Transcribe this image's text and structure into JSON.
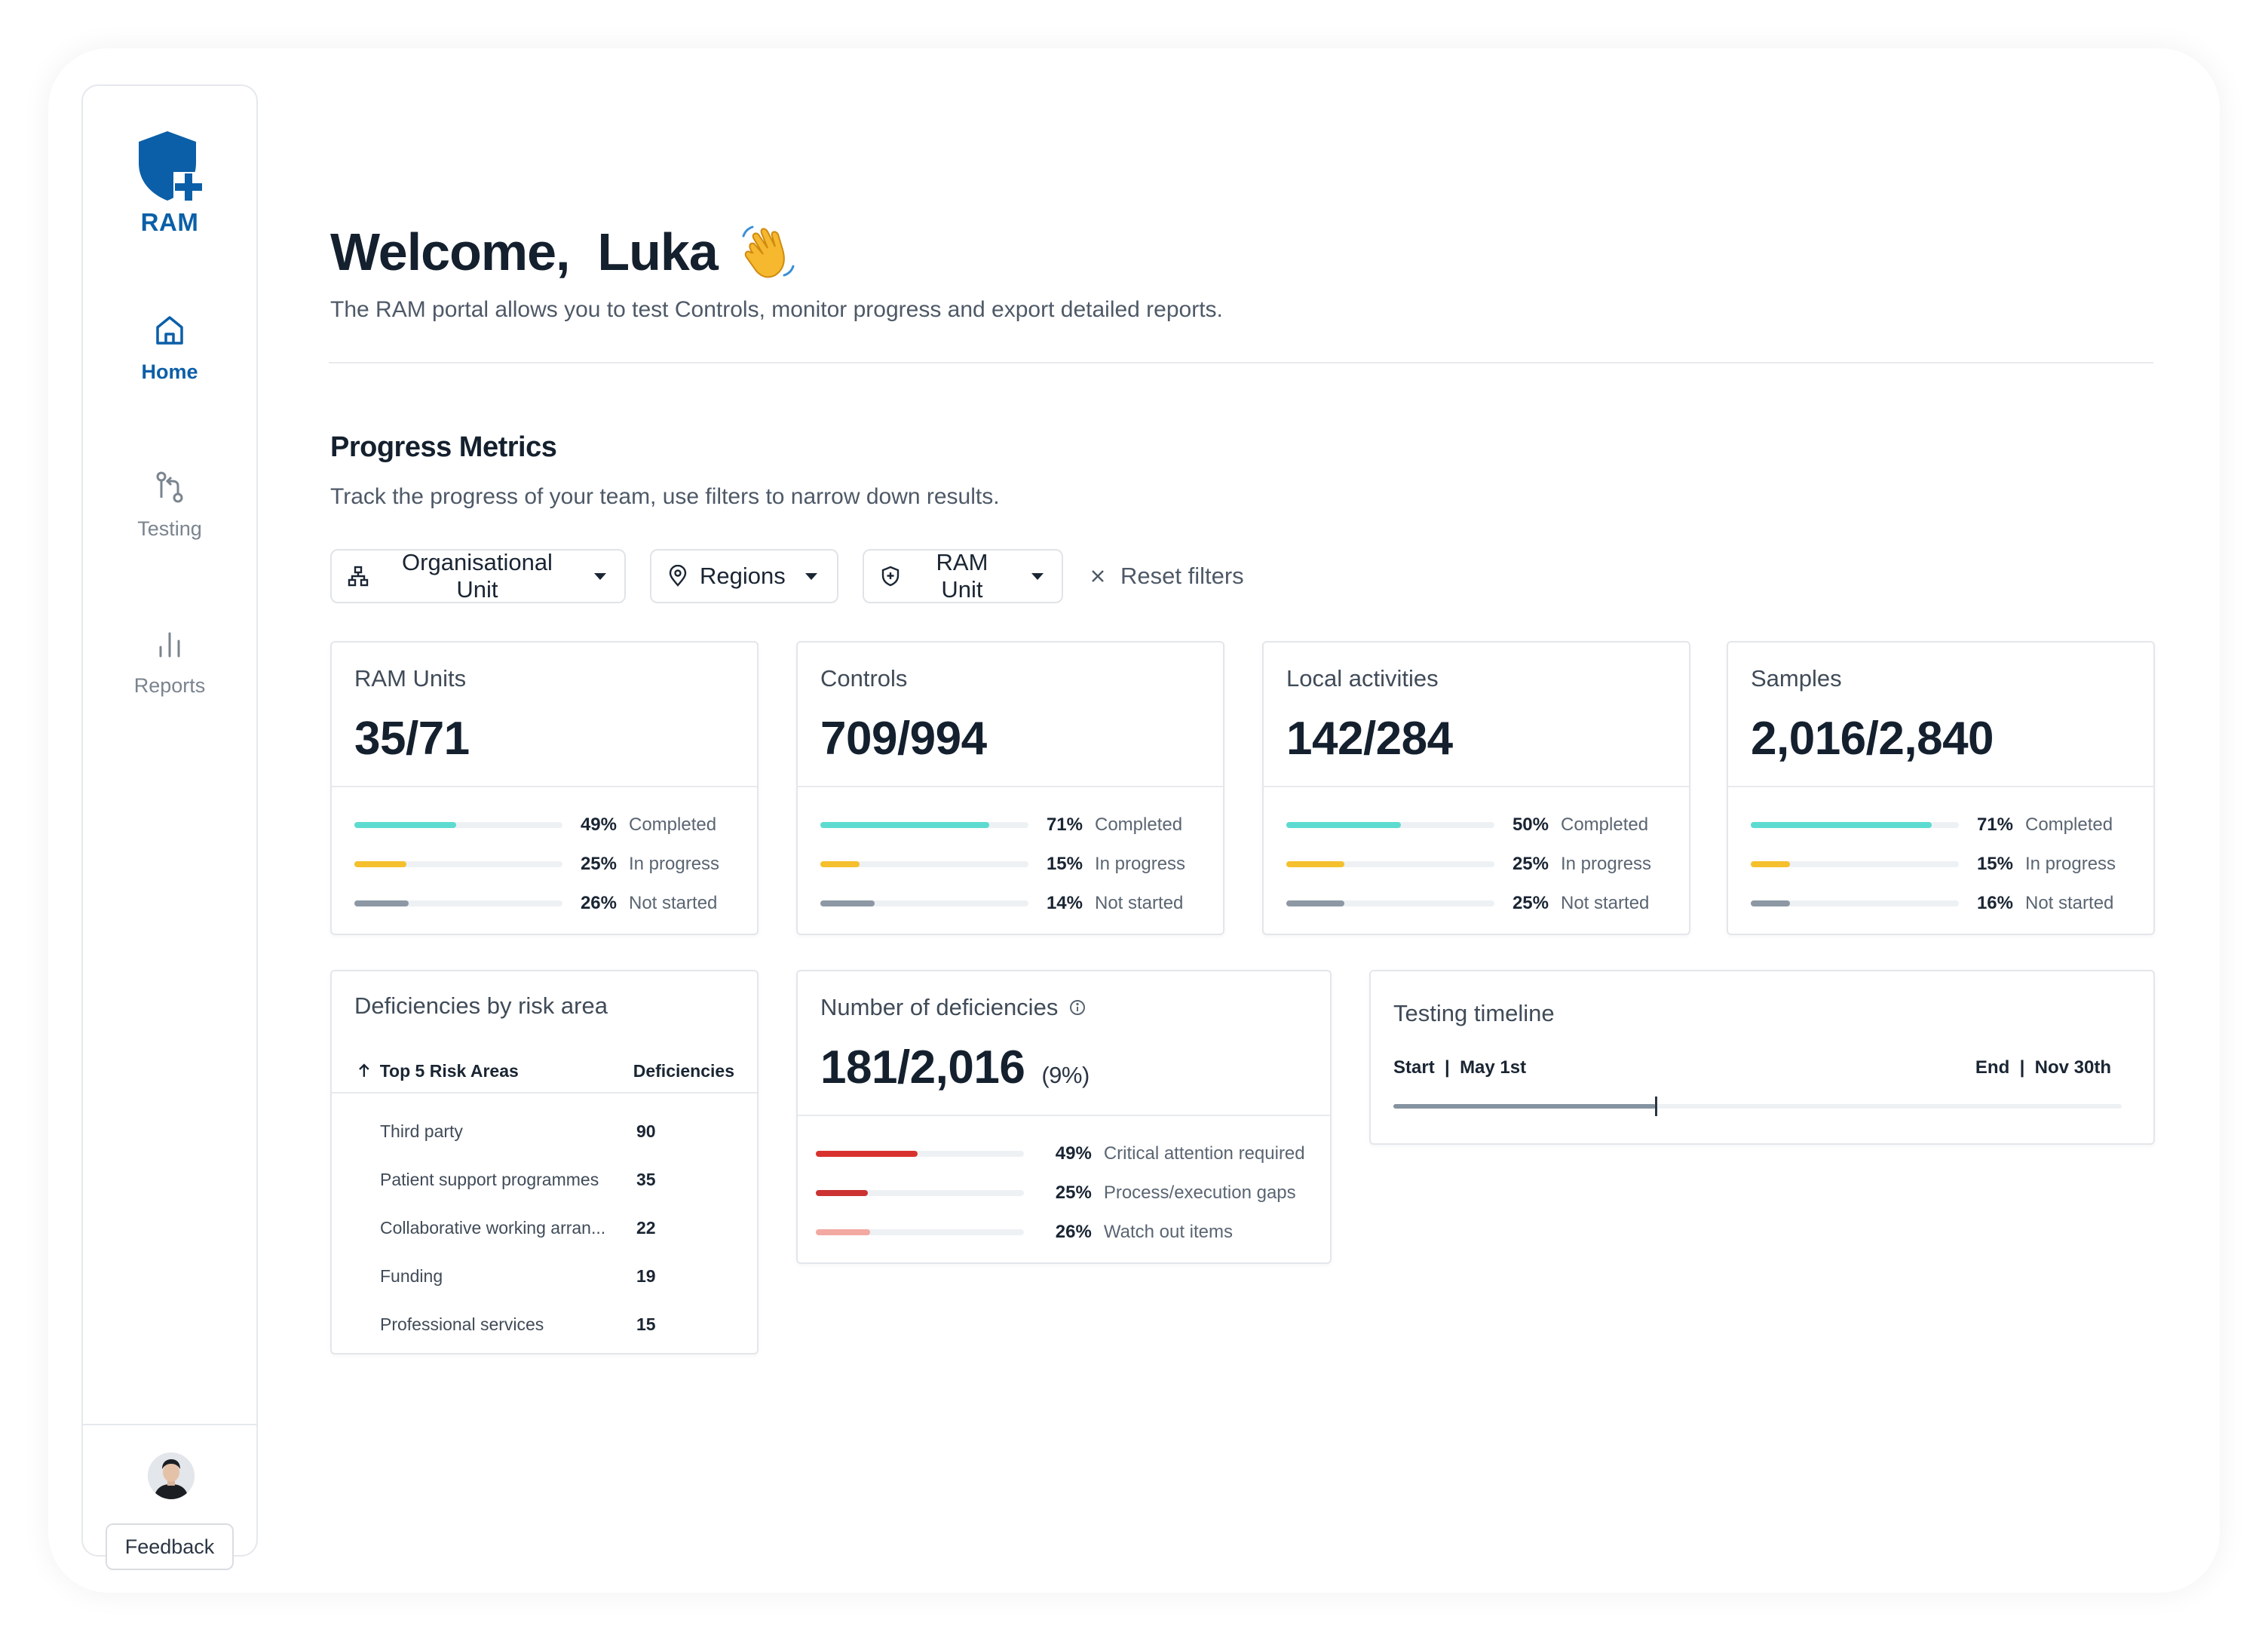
{
  "brand": {
    "logo_text": "RAM",
    "color": "#0b5fa8"
  },
  "nav": {
    "items": [
      {
        "label": "Home",
        "icon": "home-icon",
        "active": true
      },
      {
        "label": "Testing",
        "icon": "git-compare-icon",
        "active": false
      },
      {
        "label": "Reports",
        "icon": "bar-chart-icon",
        "active": false
      }
    ],
    "feedback_label": "Feedback"
  },
  "header": {
    "title": "Welcome,  Luka",
    "emoji": "waving-hand-icon",
    "subtitle": "The RAM portal allows you to test Controls, monitor progress and export detailed reports."
  },
  "section": {
    "title": "Progress Metrics",
    "subtitle": "Track the progress of your team, use filters to narrow down results."
  },
  "filters": {
    "items": [
      {
        "label": "Organisational Unit",
        "icon": "org-chart-icon"
      },
      {
        "label": "Regions",
        "icon": "location-pin-icon"
      },
      {
        "label": "RAM Unit",
        "icon": "shield-plus-icon"
      }
    ],
    "reset_label": "Reset filters"
  },
  "colors": {
    "completed": "#5ddbd0",
    "in_progress": "#f5c02e",
    "not_started": "#8d98a4",
    "critical": "#d9322e",
    "process": "#cc3232",
    "watch": "#f2a9a2"
  },
  "metrics": [
    {
      "label": "RAM Units",
      "value": "35/71",
      "rows": [
        {
          "pct": 49,
          "pct_text": "49%",
          "label": "Completed"
        },
        {
          "pct": 25,
          "pct_text": "25%",
          "label": "In progress"
        },
        {
          "pct": 26,
          "pct_text": "26%",
          "label": "Not started"
        }
      ]
    },
    {
      "label": "Controls",
      "value": "709/994",
      "rows": [
        {
          "pct": 81,
          "pct_text": "71%",
          "label": "Completed"
        },
        {
          "pct": 19,
          "pct_text": "15%",
          "label": "In progress"
        },
        {
          "pct": 26,
          "pct_text": "14%",
          "label": "Not started"
        }
      ]
    },
    {
      "label": "Local activities",
      "value": "142/284",
      "rows": [
        {
          "pct": 55,
          "pct_text": "50%",
          "label": "Completed"
        },
        {
          "pct": 28,
          "pct_text": "25%",
          "label": "In progress"
        },
        {
          "pct": 28,
          "pct_text": "25%",
          "label": "Not started"
        }
      ]
    },
    {
      "label": "Samples",
      "value": "2,016/2,840",
      "rows": [
        {
          "pct": 87,
          "pct_text": "71%",
          "label": "Completed"
        },
        {
          "pct": 19,
          "pct_text": "15%",
          "label": "In progress"
        },
        {
          "pct": 19,
          "pct_text": "16%",
          "label": "Not started"
        }
      ]
    }
  ],
  "deficiencies_by_risk": {
    "title": "Deficiencies by risk area",
    "col_area": "Top 5 Risk Areas",
    "col_count": "Deficiencies",
    "rows": [
      {
        "name": "Third party",
        "count": "90"
      },
      {
        "name": "Patient support programmes",
        "count": "35"
      },
      {
        "name": "Collaborative working arran...",
        "count": "22"
      },
      {
        "name": "Funding",
        "count": "19"
      },
      {
        "name": "Professional services",
        "count": "15"
      }
    ]
  },
  "number_of_deficiencies": {
    "title": "Number of deficiencies",
    "value": "181/2,016",
    "percent": "(9%)",
    "rows": [
      {
        "pct": 49,
        "pct_text": "49%",
        "label": "Critical attention required"
      },
      {
        "pct": 25,
        "pct_text": "25%",
        "label": "Process/execution gaps"
      },
      {
        "pct": 26,
        "pct_text": "26%",
        "label": "Watch out items"
      }
    ]
  },
  "timeline": {
    "title": "Testing timeline",
    "start": "Start  |  May 1st",
    "end": "End  |  Nov 30th",
    "progress": 0.36
  }
}
